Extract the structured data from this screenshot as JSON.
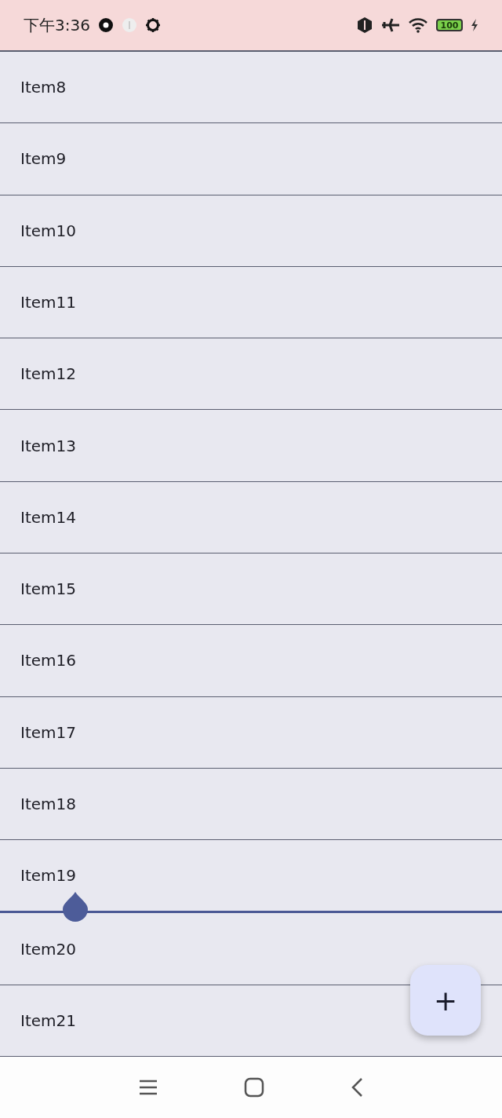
{
  "status_bar": {
    "time": "下午3:36",
    "battery": "100"
  },
  "list": {
    "items": [
      {
        "label": "Item8",
        "drop_target": false
      },
      {
        "label": "Item9",
        "drop_target": false
      },
      {
        "label": "Item10",
        "drop_target": false
      },
      {
        "label": "Item11",
        "drop_target": false
      },
      {
        "label": "Item12",
        "drop_target": false
      },
      {
        "label": "Item13",
        "drop_target": false
      },
      {
        "label": "Item14",
        "drop_target": false
      },
      {
        "label": "Item15",
        "drop_target": false
      },
      {
        "label": "Item16",
        "drop_target": false
      },
      {
        "label": "Item17",
        "drop_target": false
      },
      {
        "label": "Item18",
        "drop_target": false
      },
      {
        "label": "Item19",
        "drop_target": true
      },
      {
        "label": "Item20",
        "drop_target": false
      },
      {
        "label": "Item21",
        "drop_target": false
      }
    ]
  },
  "fab": {
    "label": "+"
  }
}
